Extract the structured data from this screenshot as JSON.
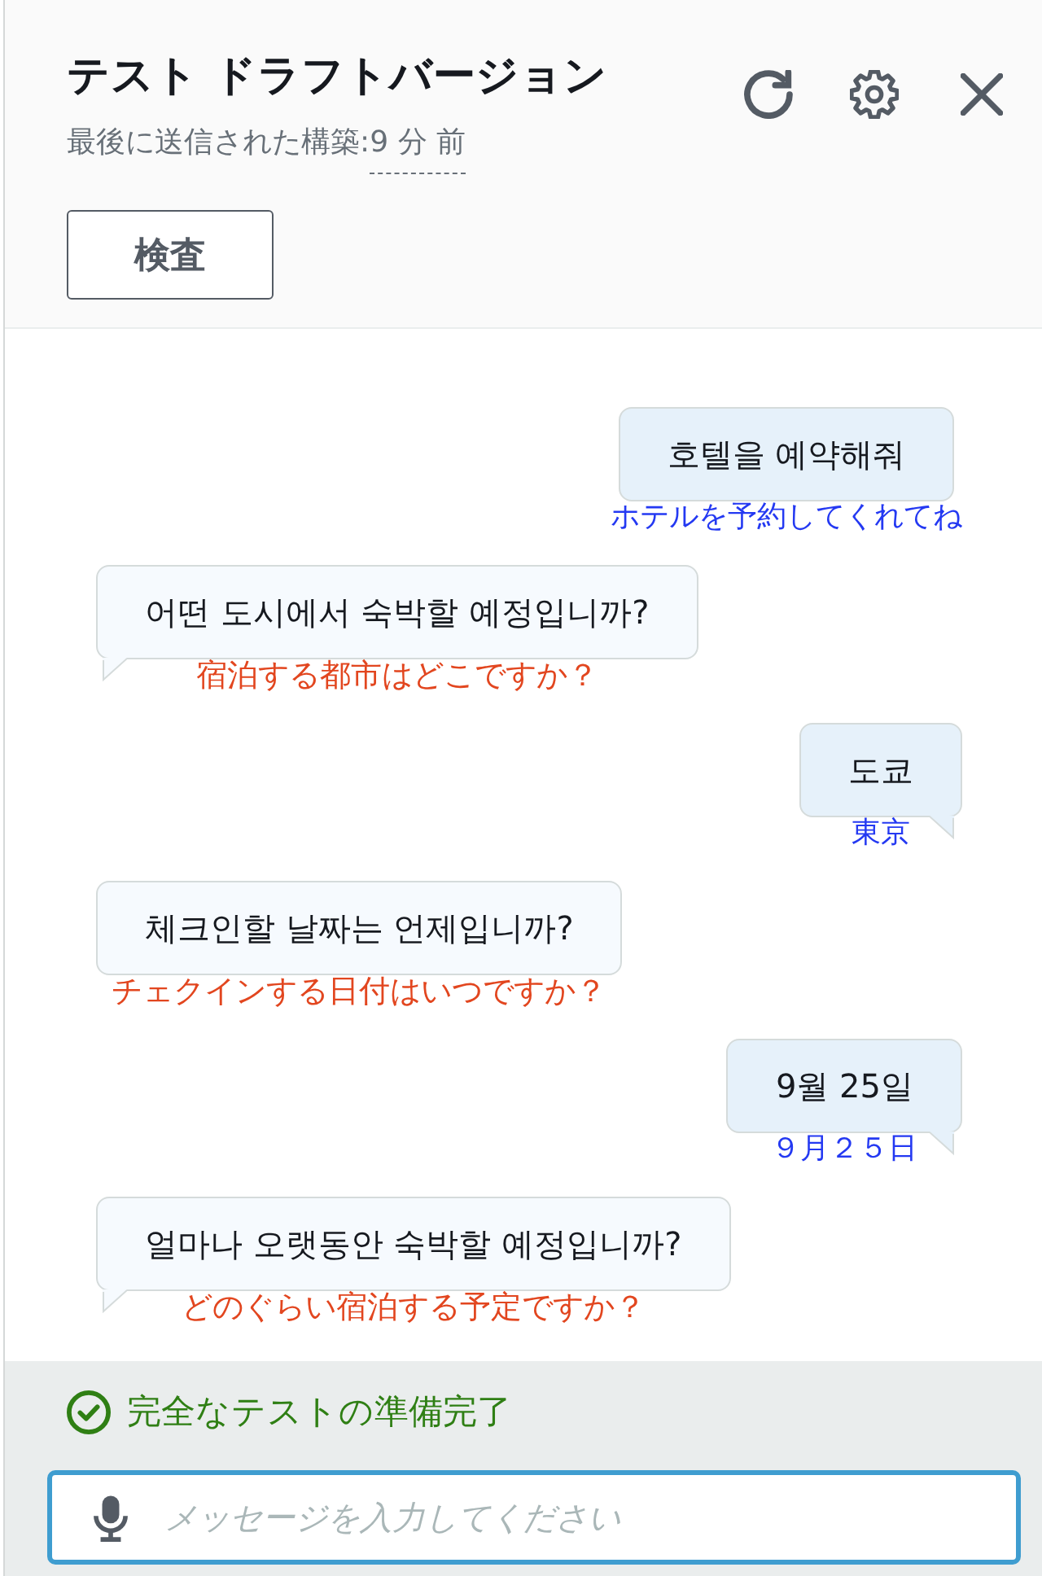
{
  "header": {
    "title": "テスト ドラフトバージョン",
    "build_label": "最後に送信された構築:",
    "build_time": "9 分 前",
    "inspect_button": "検査"
  },
  "messages": [
    {
      "kind": "user",
      "text": "호텔을 예약해줘",
      "translation": "ホテルを予約してくれてね"
    },
    {
      "kind": "bot",
      "text": "어떤 도시에서 숙박할 예정입니까?",
      "translation": "宿泊する都市はどこですか？"
    },
    {
      "kind": "user",
      "text": "도쿄",
      "translation": "東京"
    },
    {
      "kind": "bot",
      "text": "체크인할 날짜는 언제입니까?",
      "translation": "チェクインする日付はいつですか？"
    },
    {
      "kind": "user",
      "text": "9월 25일",
      "translation": "９月２５日"
    },
    {
      "kind": "bot",
      "text": "얼마나 오랫동안 숙박할 예정입니까?",
      "translation": "どのぐらい宿泊する予定ですか？"
    }
  ],
  "status": {
    "text": "完全なテストの準備完了"
  },
  "input": {
    "placeholder": "メッセージを入力してください"
  }
}
